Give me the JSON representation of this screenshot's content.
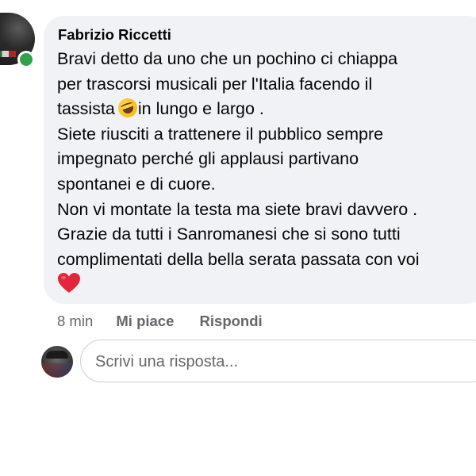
{
  "comment": {
    "author": "Fabrizio Riccetti",
    "lines": [
      "Bravi detto da uno che un pochino ci chiappa",
      "per trascorsi musicali per l'Italia facendo il",
      "tassista",
      "in lungo e largo .",
      "Siete riusciti a trattenere il pubblico sempre",
      "impegnato perché gli applausi partivano",
      "spontanei e di cuore.",
      "Non vi montate la testa ma siete bravi davvero .",
      "Grazie da tutti i Sanromanesi che si sono tutti",
      "complimentati della bella serata passata con voi"
    ],
    "emoji_inline": "rolling-on-floor-laughing-icon",
    "emoji_end": "red-heart-icon",
    "online": true
  },
  "actions": {
    "time": "8 min",
    "like_label": "Mi piace",
    "reply_label": "Rispondi"
  },
  "reply": {
    "placeholder": "Scrivi una risposta..."
  },
  "colors": {
    "bubble": "#f0f2f5",
    "online": "#31a24c",
    "secondary_text": "#65676b",
    "heart": "#e0245e"
  }
}
